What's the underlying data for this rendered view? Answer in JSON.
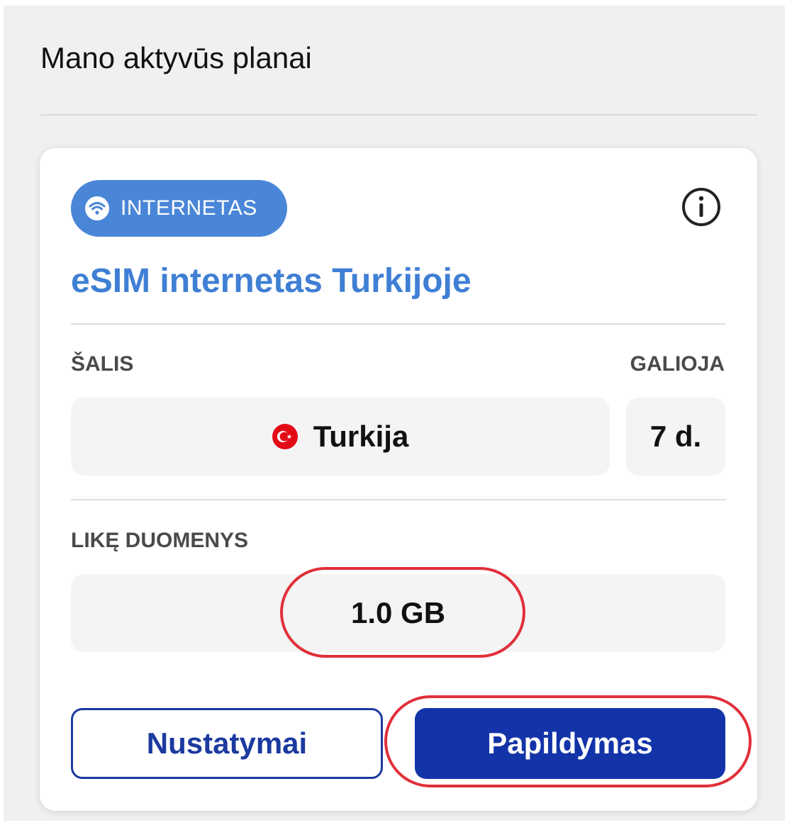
{
  "page": {
    "title": "Mano aktyvūs planai"
  },
  "plan": {
    "badge_label": "INTERNETAS",
    "badge_icon": "wifi-icon",
    "info_icon": "info-icon",
    "title": "eSIM internetas Turkijoje",
    "country_label": "ŠALIS",
    "valid_label": "GALIOJA",
    "country_name": "Turkija",
    "country_flag": "turkey-flag-icon",
    "valid_value": "7 d.",
    "remaining_label": "LIKĘ DUOMENYS",
    "remaining_value": "1.0 GB"
  },
  "actions": {
    "settings_label": "Nustatymai",
    "topup_label": "Papildymas"
  },
  "colors": {
    "badge": "#4a86d8",
    "title": "#3f7fd4",
    "primary_button": "#1333a8",
    "secondary_border": "#1c3aa0",
    "highlight": "#e0303a",
    "flag": "#e30a17"
  }
}
